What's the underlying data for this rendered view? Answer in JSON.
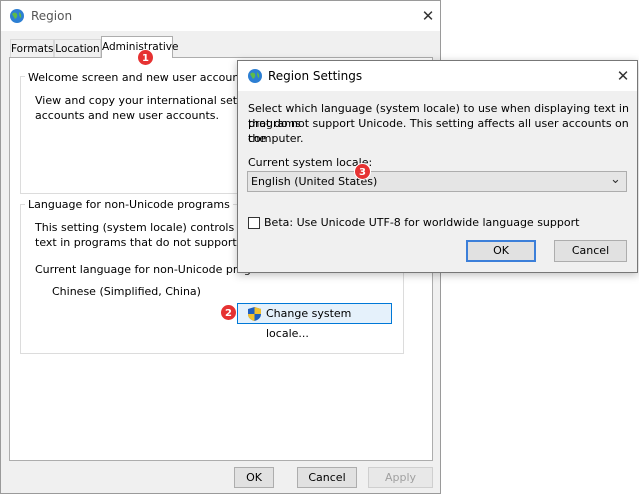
{
  "region": {
    "title": "Region",
    "close_glyph": "✕",
    "tabs": [
      {
        "label": "Formats"
      },
      {
        "label": "Location"
      },
      {
        "label": "Administrative"
      }
    ],
    "welcome_group": {
      "label": "Welcome screen and new user accounts",
      "text_line1": "View and copy your international settings t",
      "text_line2": "accounts and new user accounts."
    },
    "nonunicode_group": {
      "label": "Language for non-Unicode programs",
      "text_line1": "This setting (system locale) controls the lan",
      "text_line2": "text in programs that do not support Unicod",
      "current_label": "Current language for non-Unicode program",
      "current_value": "Chinese (Simplified, China)",
      "change_button": "Change system locale..."
    },
    "buttons": {
      "ok": "OK",
      "cancel": "Cancel",
      "apply": "Apply"
    }
  },
  "settings": {
    "title": "Region Settings",
    "close_glyph": "✕",
    "description_line1": "Select which language (system locale) to use when displaying text in programs",
    "description_line2": "that do not support Unicode. This setting affects all user accounts on the",
    "description_line3": "computer.",
    "locale_label": "Current system locale:",
    "locale_value": "English (United States)",
    "dropdown_glyph": "⌄",
    "beta_checkbox_label": "Beta: Use Unicode UTF-8 for worldwide language support",
    "beta_checked": false,
    "buttons": {
      "ok": "OK",
      "cancel": "Cancel"
    }
  },
  "badges": [
    "1",
    "2",
    "3"
  ],
  "icons": {
    "app": "globe-icon",
    "uac": "uac-shield-icon"
  },
  "colors": {
    "badge": "#e63232",
    "accent": "#3c7fd9",
    "uac_blue": "#1f5fbf",
    "uac_yellow": "#f2c12e"
  }
}
